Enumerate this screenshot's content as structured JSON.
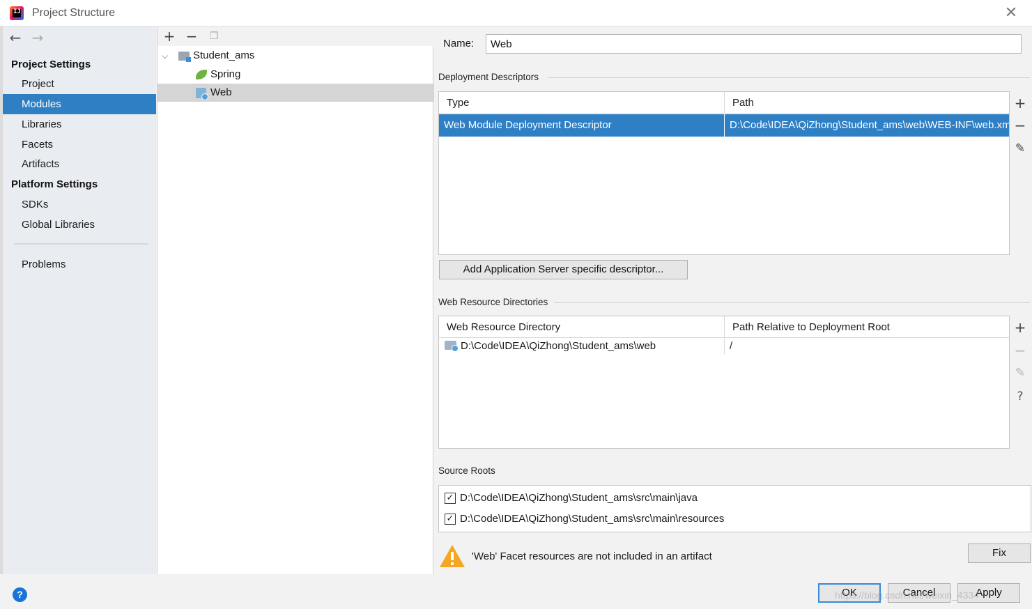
{
  "window": {
    "title": "Project Structure"
  },
  "sidebar": {
    "project_settings_header": "Project Settings",
    "platform_settings_header": "Platform Settings",
    "items": [
      {
        "label": "Project"
      },
      {
        "label": "Modules"
      },
      {
        "label": "Libraries"
      },
      {
        "label": "Facets"
      },
      {
        "label": "Artifacts"
      },
      {
        "label": "SDKs"
      },
      {
        "label": "Global Libraries"
      },
      {
        "label": "Problems"
      }
    ]
  },
  "tree": {
    "nodes": [
      {
        "label": "Student_ams",
        "icon": "module-folder-icon"
      },
      {
        "label": "Spring",
        "icon": "spring-leaf-icon"
      },
      {
        "label": "Web",
        "icon": "web-facet-icon"
      }
    ]
  },
  "facet": {
    "name_label": "Name:",
    "name_value": "Web",
    "deployment": {
      "title": "Deployment Descriptors",
      "columns": [
        "Type",
        "Path"
      ],
      "rows": [
        {
          "type": "Web Module Deployment Descriptor",
          "path": "D:\\Code\\IDEA\\QiZhong\\Student_ams\\web\\WEB-INF\\web.xml"
        }
      ],
      "add_server_button": "Add Application Server specific descriptor..."
    },
    "resources": {
      "title": "Web Resource Directories",
      "columns": [
        "Web Resource Directory",
        "Path Relative to Deployment Root"
      ],
      "rows": [
        {
          "directory": "D:\\Code\\IDEA\\QiZhong\\Student_ams\\web",
          "relative": "/"
        }
      ]
    },
    "source_roots": {
      "title": "Source Roots",
      "items": [
        {
          "path": "D:\\Code\\IDEA\\QiZhong\\Student_ams\\src\\main\\java",
          "checked": true
        },
        {
          "path": "D:\\Code\\IDEA\\QiZhong\\Student_ams\\src\\main\\resources",
          "checked": true
        }
      ]
    },
    "warning": {
      "text": "'Web' Facet resources are not included in an artifact",
      "fix_button": "Fix"
    }
  },
  "buttons": {
    "ok": "OK",
    "cancel": "Cancel",
    "apply": "Apply"
  },
  "watermark": "https://blog.csdn.net/weixin_4334",
  "colors": {
    "selection": "#2f7fc4",
    "sidebar_bg": "#e9edf2",
    "warning": "#f5a623"
  }
}
